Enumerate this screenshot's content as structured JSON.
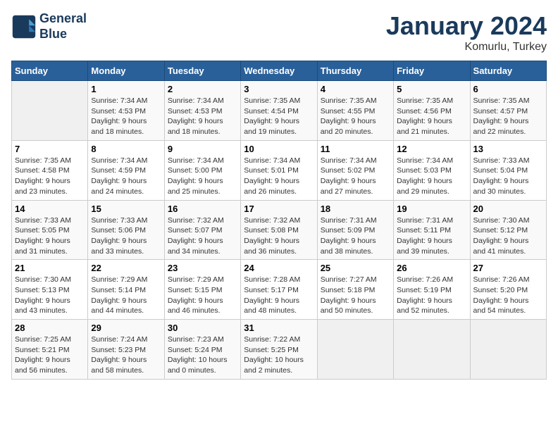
{
  "header": {
    "logo_line1": "General",
    "logo_line2": "Blue",
    "month": "January 2024",
    "location": "Komurlu, Turkey"
  },
  "columns": [
    "Sunday",
    "Monday",
    "Tuesday",
    "Wednesday",
    "Thursday",
    "Friday",
    "Saturday"
  ],
  "weeks": [
    [
      {
        "day": "",
        "info": ""
      },
      {
        "day": "1",
        "info": "Sunrise: 7:34 AM\nSunset: 4:53 PM\nDaylight: 9 hours\nand 18 minutes."
      },
      {
        "day": "2",
        "info": "Sunrise: 7:34 AM\nSunset: 4:53 PM\nDaylight: 9 hours\nand 18 minutes."
      },
      {
        "day": "3",
        "info": "Sunrise: 7:35 AM\nSunset: 4:54 PM\nDaylight: 9 hours\nand 19 minutes."
      },
      {
        "day": "4",
        "info": "Sunrise: 7:35 AM\nSunset: 4:55 PM\nDaylight: 9 hours\nand 20 minutes."
      },
      {
        "day": "5",
        "info": "Sunrise: 7:35 AM\nSunset: 4:56 PM\nDaylight: 9 hours\nand 21 minutes."
      },
      {
        "day": "6",
        "info": "Sunrise: 7:35 AM\nSunset: 4:57 PM\nDaylight: 9 hours\nand 22 minutes."
      }
    ],
    [
      {
        "day": "7",
        "info": "Sunrise: 7:35 AM\nSunset: 4:58 PM\nDaylight: 9 hours\nand 23 minutes."
      },
      {
        "day": "8",
        "info": "Sunrise: 7:34 AM\nSunset: 4:59 PM\nDaylight: 9 hours\nand 24 minutes."
      },
      {
        "day": "9",
        "info": "Sunrise: 7:34 AM\nSunset: 5:00 PM\nDaylight: 9 hours\nand 25 minutes."
      },
      {
        "day": "10",
        "info": "Sunrise: 7:34 AM\nSunset: 5:01 PM\nDaylight: 9 hours\nand 26 minutes."
      },
      {
        "day": "11",
        "info": "Sunrise: 7:34 AM\nSunset: 5:02 PM\nDaylight: 9 hours\nand 27 minutes."
      },
      {
        "day": "12",
        "info": "Sunrise: 7:34 AM\nSunset: 5:03 PM\nDaylight: 9 hours\nand 29 minutes."
      },
      {
        "day": "13",
        "info": "Sunrise: 7:33 AM\nSunset: 5:04 PM\nDaylight: 9 hours\nand 30 minutes."
      }
    ],
    [
      {
        "day": "14",
        "info": "Sunrise: 7:33 AM\nSunset: 5:05 PM\nDaylight: 9 hours\nand 31 minutes."
      },
      {
        "day": "15",
        "info": "Sunrise: 7:33 AM\nSunset: 5:06 PM\nDaylight: 9 hours\nand 33 minutes."
      },
      {
        "day": "16",
        "info": "Sunrise: 7:32 AM\nSunset: 5:07 PM\nDaylight: 9 hours\nand 34 minutes."
      },
      {
        "day": "17",
        "info": "Sunrise: 7:32 AM\nSunset: 5:08 PM\nDaylight: 9 hours\nand 36 minutes."
      },
      {
        "day": "18",
        "info": "Sunrise: 7:31 AM\nSunset: 5:09 PM\nDaylight: 9 hours\nand 38 minutes."
      },
      {
        "day": "19",
        "info": "Sunrise: 7:31 AM\nSunset: 5:11 PM\nDaylight: 9 hours\nand 39 minutes."
      },
      {
        "day": "20",
        "info": "Sunrise: 7:30 AM\nSunset: 5:12 PM\nDaylight: 9 hours\nand 41 minutes."
      }
    ],
    [
      {
        "day": "21",
        "info": "Sunrise: 7:30 AM\nSunset: 5:13 PM\nDaylight: 9 hours\nand 43 minutes."
      },
      {
        "day": "22",
        "info": "Sunrise: 7:29 AM\nSunset: 5:14 PM\nDaylight: 9 hours\nand 44 minutes."
      },
      {
        "day": "23",
        "info": "Sunrise: 7:29 AM\nSunset: 5:15 PM\nDaylight: 9 hours\nand 46 minutes."
      },
      {
        "day": "24",
        "info": "Sunrise: 7:28 AM\nSunset: 5:17 PM\nDaylight: 9 hours\nand 48 minutes."
      },
      {
        "day": "25",
        "info": "Sunrise: 7:27 AM\nSunset: 5:18 PM\nDaylight: 9 hours\nand 50 minutes."
      },
      {
        "day": "26",
        "info": "Sunrise: 7:26 AM\nSunset: 5:19 PM\nDaylight: 9 hours\nand 52 minutes."
      },
      {
        "day": "27",
        "info": "Sunrise: 7:26 AM\nSunset: 5:20 PM\nDaylight: 9 hours\nand 54 minutes."
      }
    ],
    [
      {
        "day": "28",
        "info": "Sunrise: 7:25 AM\nSunset: 5:21 PM\nDaylight: 9 hours\nand 56 minutes."
      },
      {
        "day": "29",
        "info": "Sunrise: 7:24 AM\nSunset: 5:23 PM\nDaylight: 9 hours\nand 58 minutes."
      },
      {
        "day": "30",
        "info": "Sunrise: 7:23 AM\nSunset: 5:24 PM\nDaylight: 10 hours\nand 0 minutes."
      },
      {
        "day": "31",
        "info": "Sunrise: 7:22 AM\nSunset: 5:25 PM\nDaylight: 10 hours\nand 2 minutes."
      },
      {
        "day": "",
        "info": ""
      },
      {
        "day": "",
        "info": ""
      },
      {
        "day": "",
        "info": ""
      }
    ]
  ]
}
